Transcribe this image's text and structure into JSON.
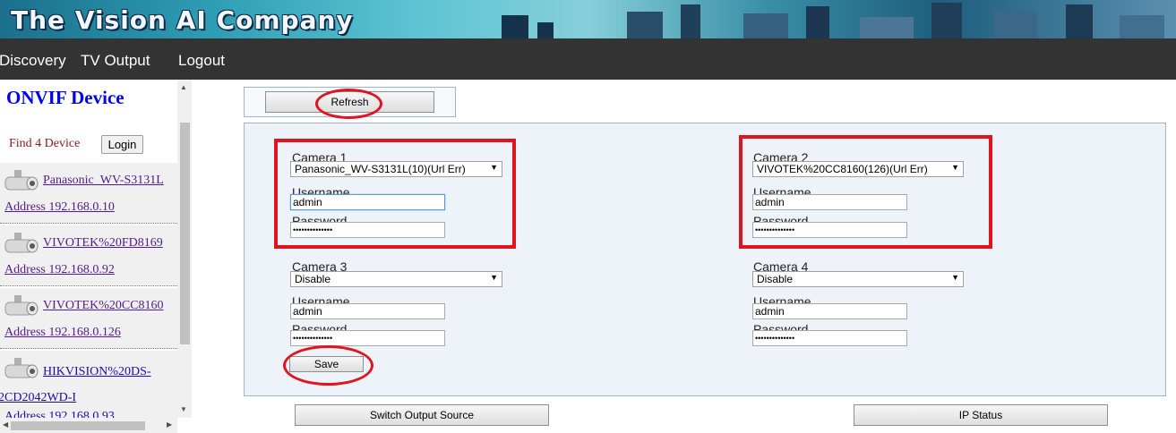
{
  "banner": {
    "title": "The Vision AI Company"
  },
  "nav": {
    "items": [
      "Discovery",
      "TV Output",
      "Logout"
    ]
  },
  "device_panel": {
    "title": "ONVIF Device",
    "find_text": "Find 4 Device",
    "login_label": "Login",
    "devices": [
      {
        "name": "Panasonic_WV-S3131L",
        "address": "Address 192.168.0.10"
      },
      {
        "name": "VIVOTEK%20FD8169",
        "address": "Address 192.168.0.92"
      },
      {
        "name": "VIVOTEK%20CC8160",
        "address": "Address 192.168.0.126"
      },
      {
        "name": "HIKVISION%20DS-",
        "name_line2": "2CD2042WD-I",
        "address": "Address 192.168.0.93"
      }
    ]
  },
  "refresh_label": "Refresh",
  "cameras": [
    {
      "label": "Camera 1",
      "selected": "Panasonic_WV-S3131L(10)(Url Err)",
      "username_label": "Username",
      "username": "admin",
      "password_label": "Password",
      "password": "••••••••••••••"
    },
    {
      "label": "Camera 2",
      "selected": "VIVOTEK%20CC8160(126)(Url Err)",
      "username_label": "Username",
      "username": "admin",
      "password_label": "Password",
      "password": "••••••••••••••"
    },
    {
      "label": "Camera 3",
      "selected": "Disable",
      "username_label": "Username",
      "username": "admin",
      "password_label": "Password",
      "password": "••••••••••••••"
    },
    {
      "label": "Camera 4",
      "selected": "Disable",
      "username_label": "Username",
      "username": "admin",
      "password_label": "Password",
      "password": "••••••••••••••"
    }
  ],
  "save_label": "Save",
  "switch_label": "Switch Output Source",
  "ip_status_label": "IP Status",
  "colors": {
    "nav_bg": "#333333",
    "annotation_red": "#e0141e",
    "panel_bg": "#edf3f8",
    "device_title": "#0000ee"
  }
}
